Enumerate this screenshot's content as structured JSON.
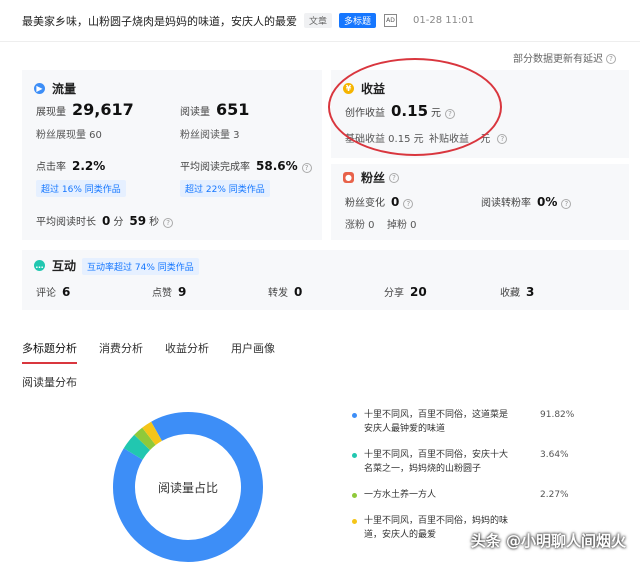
{
  "header": {
    "article_title": "最美家乡味，山粉圆子烧肉是妈妈的味道，安庆人的最爱",
    "tag_article": "文章",
    "tag_multi": "多标题",
    "ad_icon": "AD",
    "publish_time": "01-28 11:01"
  },
  "note": "部分数据更新有延迟",
  "traffic": {
    "title": "流量",
    "impressions_label": "展现量",
    "impressions_value": "29,617",
    "reads_label": "阅读量",
    "reads_value": "651",
    "fan_impressions": "粉丝展现量 60",
    "fan_reads": "粉丝阅读量 3",
    "ctr_label": "点击率",
    "ctr_value": "2.2%",
    "completion_label": "平均阅读完成率",
    "completion_value": "58.6%",
    "ctr_badge": "超过 16% 同类作品",
    "completion_badge": "超过 22% 同类作品",
    "avg_time_label": "平均阅读时长",
    "avg_time_min": "0",
    "avg_time_min_unit": "分",
    "avg_time_sec": "59",
    "avg_time_sec_unit": "秒"
  },
  "earnings": {
    "title": "收益",
    "creation_label": "创作收益",
    "creation_value": "0.15",
    "creation_unit": "元",
    "basic": "基础收益 0.15 元",
    "subsidy": "补贴收益",
    "subsidy_unit": "元"
  },
  "fans": {
    "title": "粉丝",
    "change_label": "粉丝变化",
    "change_value": "0",
    "conversion_label": "阅读转粉率",
    "conversion_value": "0%",
    "gain": "涨粉 0",
    "loss": "掉粉 0"
  },
  "interaction": {
    "title": "互动",
    "badge": "互动率超过 74% 同类作品",
    "comments_label": "评论",
    "comments_value": "6",
    "likes_label": "点赞",
    "likes_value": "9",
    "shares_label": "转发",
    "shares_value": "0",
    "share2_label": "分享",
    "share2_value": "20",
    "favorites_label": "收藏",
    "favorites_value": "3"
  },
  "tabs": [
    "多标题分析",
    "消费分析",
    "收益分析",
    "用户画像"
  ],
  "section_label": "阅读量分布",
  "donut_center": "阅读量占比",
  "chart_data": {
    "type": "pie",
    "categories": [
      "十里不同风，百里不同俗，这道菜是安庆人最钟爱的味道",
      "十里不同风，百里不同俗，安庆十大名菜之一，妈妈烧的山粉圆子",
      "一方水土养一方人",
      "十里不同风，百里不同俗，妈妈的味道，安庆人的最爱"
    ],
    "values": [
      91.82,
      3.64,
      2.27,
      2.27
    ],
    "labels": [
      "91.82%",
      "3.64%",
      "2.27%",
      ""
    ],
    "colors": [
      "#3d8ef7",
      "#21c7b0",
      "#8fc93a",
      "#f5c518"
    ]
  },
  "legend_line4": "十里不同风，百里不同俗，妈妈的味道，安庆人的最爱",
  "watermark": "头条 @小明聊人间烟火",
  "colors": {
    "accent": "#1677ff",
    "highlight": "#d9363e"
  }
}
